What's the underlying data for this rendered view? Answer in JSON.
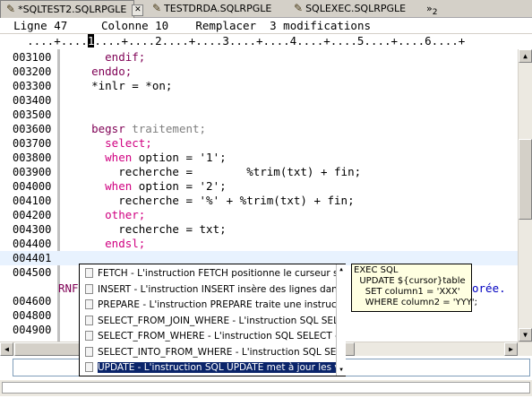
{
  "tabs": [
    {
      "label": "*SQLTEST2.SQLRPGLE",
      "active": true,
      "close": "✕"
    },
    {
      "label": "TESTDRDA.SQLRPGLE"
    },
    {
      "label": "SQLEXEC.SQLRPGLE"
    },
    {
      "label": "2",
      "prefix": "»"
    }
  ],
  "status": {
    "line_label": "Ligne",
    "line_value": "47",
    "col_label": "Colonne",
    "col_value": "10",
    "mode": "Remplacer",
    "mods": "3 modifications"
  },
  "ruler": {
    "before": "    ....+....",
    "cursor": "1",
    "after": "....+....2....+....3....+....4....+....5....+....6....+"
  },
  "lines": [
    {
      "num": "003100",
      "code": "      endif;",
      "style": "kw"
    },
    {
      "num": "003200",
      "code": "    enddo;",
      "style": "kw"
    },
    {
      "num": "003300",
      "code": "    *inlr = *on;",
      "style": "plain"
    },
    {
      "num": "003400",
      "code": "",
      "style": "plain"
    },
    {
      "num": "003500",
      "code": "",
      "style": "plain"
    },
    {
      "num": "003600",
      "code_kw": "    begsr",
      "code_rest": " traitement;",
      "style": "begsr"
    },
    {
      "num": "003700",
      "code": "      select;",
      "style": "kw2"
    },
    {
      "num": "003800",
      "code_kw": "      when",
      "code_rest": " option = '1';",
      "style": "when"
    },
    {
      "num": "003900",
      "code": "        recherche =        %trim(txt) + fin;",
      "style": "plain"
    },
    {
      "num": "004000",
      "code_kw": "      when",
      "code_rest": " option = '2';",
      "style": "when"
    },
    {
      "num": "004100",
      "code": "        recherche = '%' + %trim(txt) + fin;",
      "style": "plain"
    },
    {
      "num": "004200",
      "code": "      other;",
      "style": "kw2"
    },
    {
      "num": "004300",
      "code": "        recherche = txt;",
      "style": "plain"
    },
    {
      "num": "004400",
      "code": "      endsl;",
      "style": "kw2"
    },
    {
      "num": "004401",
      "code": "",
      "style": "current"
    },
    {
      "num": "004500",
      "code": "",
      "style": "plain"
    },
    {
      "num": "",
      "code": "",
      "style": "plain"
    },
    {
      "num": "004600",
      "code": "",
      "style": "plain"
    },
    {
      "num": "004800",
      "code": "",
      "style": "plain"
    },
    {
      "num": "004900",
      "code": "",
      "style": "plain"
    }
  ],
  "rnf_fragment": "RNF",
  "trailing_text": "orée.",
  "proposals": [
    {
      "label": "FETCH - L'instruction FETCH positionne le curseur sur u"
    },
    {
      "label": "INSERT - L'instruction INSERT insère des lignes dans ur"
    },
    {
      "label": "PREPARE - L'instruction PREPARE traite une instruction"
    },
    {
      "label": "SELECT_FROM_JOIN_WHERE - L'instruction SQL SELECT"
    },
    {
      "label": "SELECT_FROM_WHERE - L'instruction SQL SELECT effe"
    },
    {
      "label": "SELECT_INTO_FROM_WHERE - L'instruction SQL SELEC"
    },
    {
      "label": "UPDATE - L'instruction SQL UPDATE met à jour les vale",
      "selected": true
    }
  ],
  "doc": "EXEC SQL\n  UPDATE ${cursor}table\n    SET column1 = 'XXX'\n    WHERE column2 = 'YYY';"
}
